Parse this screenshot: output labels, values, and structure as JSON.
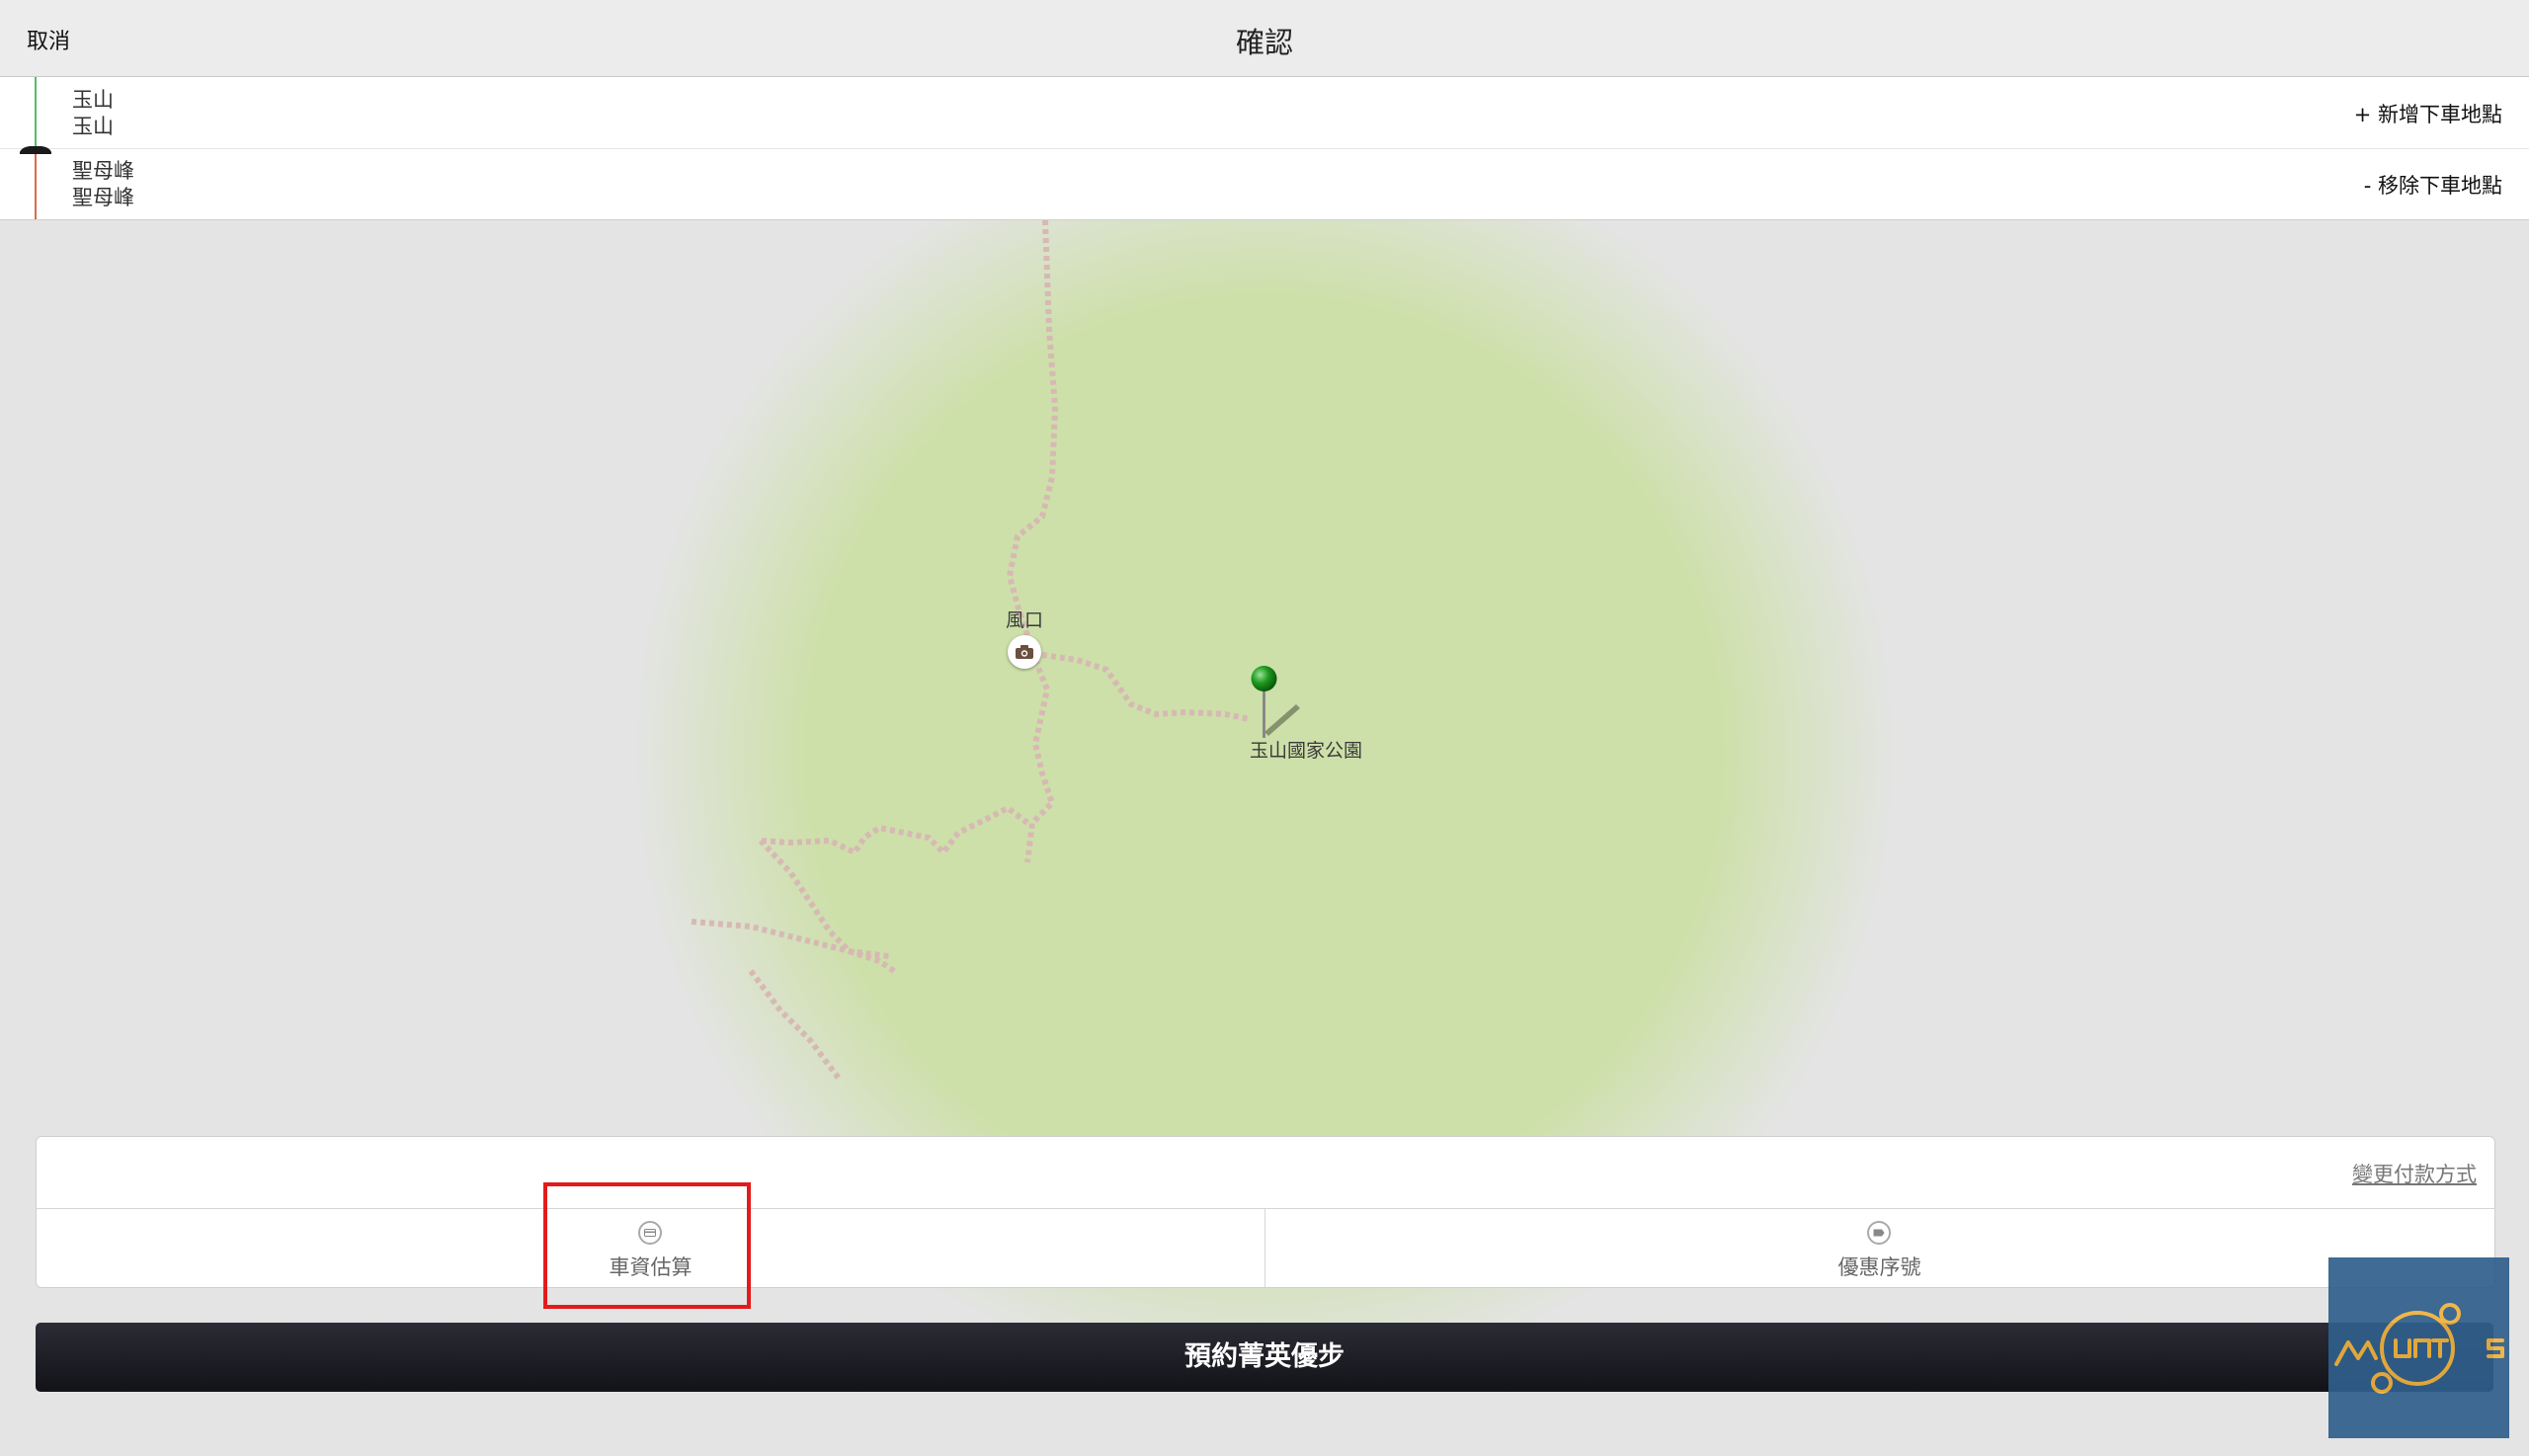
{
  "header": {
    "cancel_label": "取消",
    "title": "確認"
  },
  "route": {
    "pickup": {
      "line1": "玉山",
      "line2": "玉山",
      "action": "+ 新增下車地點"
    },
    "dropoff": {
      "line1": "聖母峰",
      "line2": "聖母峰",
      "action": "- 移除下車地點"
    }
  },
  "map": {
    "poi_label": "風口",
    "pin_label": "玉山國家公園",
    "land_color": "#cde0a9",
    "pin_color": "#1f9a1f"
  },
  "payment_panel": {
    "change_payment_label": "變更付款方式",
    "fare_estimate_label": "車資估算",
    "promo_code_label": "優惠序號"
  },
  "book_button_label": "預約菁英優步",
  "watermark": {
    "text_left": "M",
    "text_center": "UNT",
    "text_right": "S"
  }
}
